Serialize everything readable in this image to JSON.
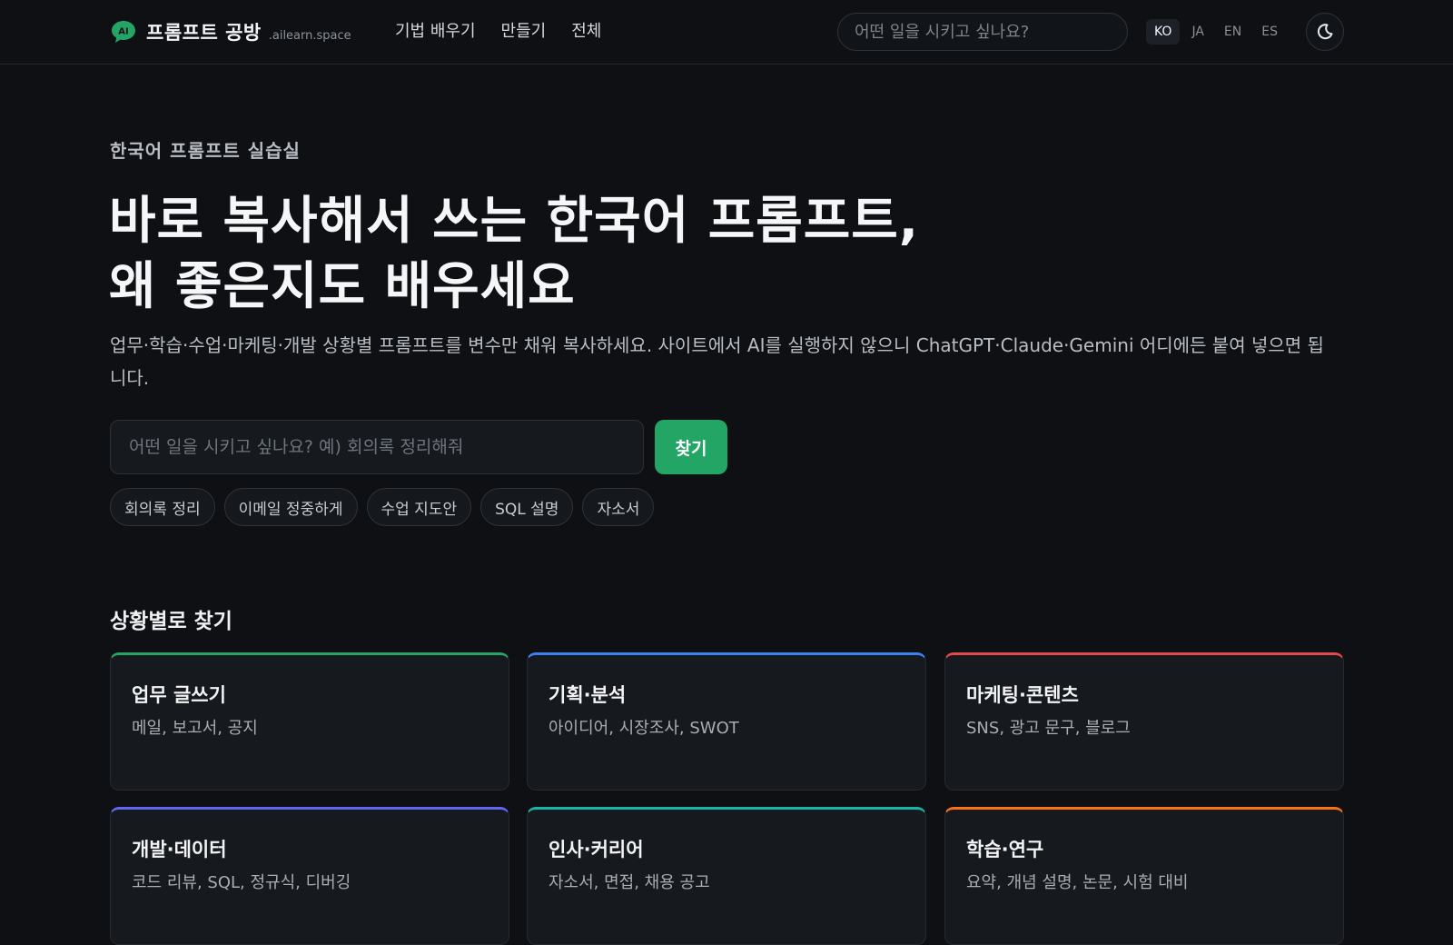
{
  "header": {
    "brand_title": "프롬프트 공방",
    "brand_domain": ".ailearn.space",
    "nav": [
      "기법 배우기",
      "만들기",
      "전체"
    ],
    "search_placeholder": "어떤 일을 시키고 싶나요?",
    "languages": [
      "KO",
      "JA",
      "EN",
      "ES"
    ],
    "active_language": "KO"
  },
  "hero": {
    "eyebrow": "한국어 프롬프트 실습실",
    "headline_line1": "바로 복사해서 쓰는 한국어 프롬프트,",
    "headline_line2": "왜 좋은지도 배우세요",
    "lead": "업무·학습·수업·마케팅·개발 상황별 프롬프트를 변수만 채워 복사하세요. 사이트에서 AI를 실행하지 않으니 ChatGPT·Claude·Gemini 어디에든 붙여 넣으면 됩니다.",
    "search_placeholder": "어떤 일을 시키고 싶나요? 예) 회의록 정리해줘",
    "search_button": "찾기",
    "chips": [
      "회의록 정리",
      "이메일 정중하게",
      "수업 지도안",
      "SQL 설명",
      "자소서"
    ]
  },
  "categories": {
    "title": "상황별로 찾기",
    "items": [
      {
        "title": "업무 글쓰기",
        "desc": "메일, 보고서, 공지",
        "accent": "#22a565"
      },
      {
        "title": "기획·분석",
        "desc": "아이디어, 시장조사, SWOT",
        "accent": "#3b82f6"
      },
      {
        "title": "마케팅·콘텐츠",
        "desc": "SNS, 광고 문구, 블로그",
        "accent": "#e5484d"
      },
      {
        "title": "개발·데이터",
        "desc": "코드 리뷰, SQL, 정규식, 디버깅",
        "accent": "#6366f1"
      },
      {
        "title": "인사·커리어",
        "desc": "자소서, 면접, 채용 공고",
        "accent": "#14b8a6"
      },
      {
        "title": "학습·연구",
        "desc": "요약, 개념 설명, 논문, 시험 대비",
        "accent": "#f97316"
      }
    ]
  },
  "colors": {
    "background": "#0e1013",
    "brand_green": "#22a565"
  },
  "icons": {
    "brand": "ai-chat-bubble-icon",
    "theme": "moon-icon"
  }
}
